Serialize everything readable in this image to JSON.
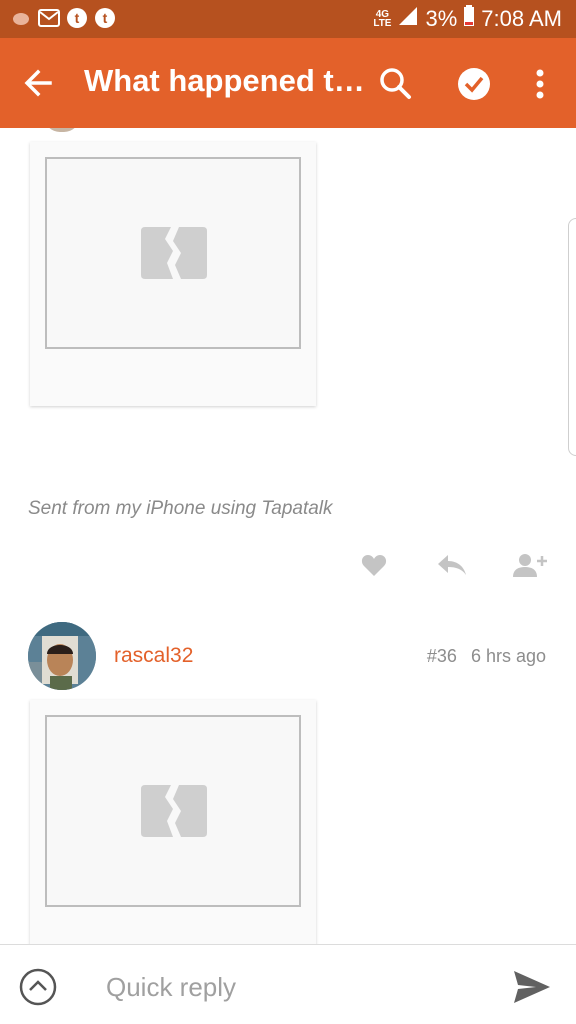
{
  "status_bar": {
    "network": "4G\nLTE",
    "battery": "3%",
    "time": "7:08 AM"
  },
  "app_bar": {
    "title": "What happened t…",
    "bg_color": "#e3612a"
  },
  "post_prev": {
    "signature": "Sent from my iPhone using Tapatalk"
  },
  "post_36": {
    "username": "rascal32",
    "number": "#36",
    "time": "6 hrs ago"
  },
  "reply": {
    "placeholder": "Quick reply"
  },
  "icons": {
    "back": "arrow-left-icon",
    "search": "search-icon",
    "check": "check-circle-icon",
    "more": "more-vert-icon",
    "like": "heart-icon",
    "reply": "reply-icon",
    "follow": "add-user-icon",
    "expand": "chevron-up-icon",
    "send": "send-icon"
  }
}
